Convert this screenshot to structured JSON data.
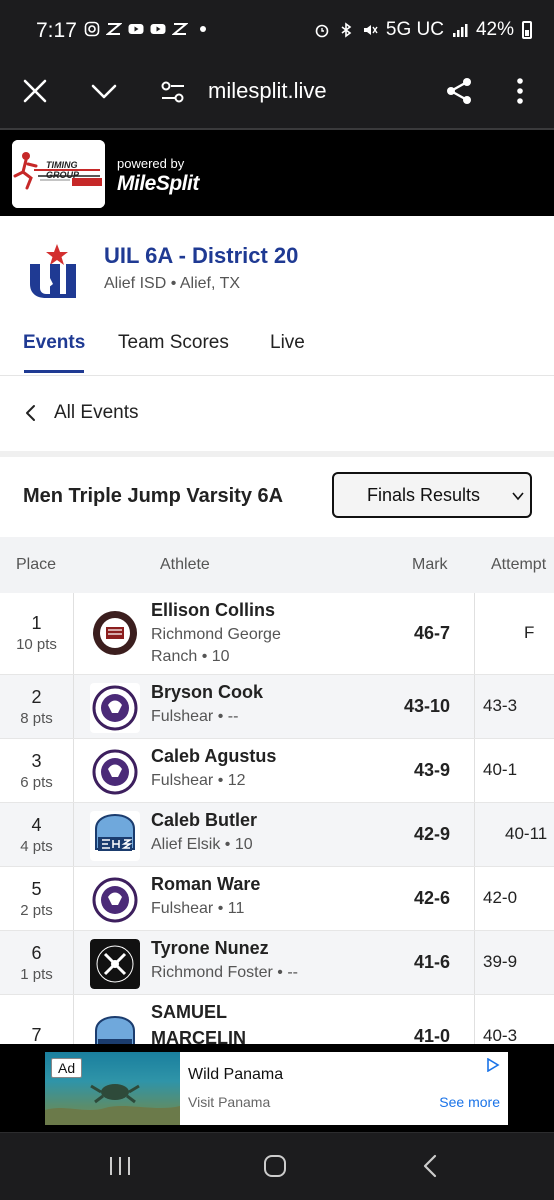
{
  "status_bar": {
    "time": "7:17",
    "network": "5G UC",
    "battery": "42%"
  },
  "browser": {
    "url": "milesplit.live"
  },
  "banner": {
    "powered_by": "powered by",
    "brand": "MileSplit",
    "timing_logo_text": "TIMING GROUP"
  },
  "meet": {
    "title": "UIL 6A - District 20",
    "subtitle": "Alief ISD • Alief, TX",
    "tabs": [
      {
        "label": "Events",
        "active": true
      },
      {
        "label": "Team Scores",
        "active": false
      },
      {
        "label": "Live",
        "active": false
      }
    ]
  },
  "nav": {
    "all_events": "All Events"
  },
  "event": {
    "title": "Men Triple Jump Varsity 6A",
    "round_select": "Finals Results"
  },
  "table": {
    "headers": {
      "place": "Place",
      "athlete": "Athlete",
      "mark": "Mark",
      "attempt": "Attempt"
    },
    "rows": [
      {
        "place": "1",
        "pts": "10 pts",
        "name": "Ellison Collins",
        "team": "Richmond George",
        "team2": "Ranch • 10",
        "mark": "46-7",
        "attempt": "F",
        "logo": "george-ranch"
      },
      {
        "place": "2",
        "pts": "8 pts",
        "name": "Bryson Cook",
        "team": "Fulshear • --",
        "mark": "43-10",
        "attempt": "43-3",
        "logo": "fulshear"
      },
      {
        "place": "3",
        "pts": "6 pts",
        "name": "Caleb Agustus",
        "team": "Fulshear • 12",
        "mark": "43-9",
        "attempt": "40-1",
        "logo": "fulshear"
      },
      {
        "place": "4",
        "pts": "4 pts",
        "name": "Caleb Butler",
        "team": "Alief Elsik • 10",
        "mark": "42-9",
        "attempt": "40-11",
        "logo": "elsik"
      },
      {
        "place": "5",
        "pts": "2 pts",
        "name": "Roman Ware",
        "team": "Fulshear • 11",
        "mark": "42-6",
        "attempt": "42-0",
        "logo": "fulshear"
      },
      {
        "place": "6",
        "pts": "1 pts",
        "name": "Tyrone Nunez",
        "team": "Richmond Foster • --",
        "mark": "41-6",
        "attempt": "39-9",
        "logo": "foster"
      },
      {
        "place": "7",
        "pts": "",
        "name": "SAMUEL",
        "name2": "MARCELIN",
        "team": "",
        "mark": "41-0",
        "attempt": "40-3",
        "logo": "elsik"
      }
    ]
  },
  "ad": {
    "badge": "Ad",
    "title": "Wild Panama",
    "advertiser": "Visit Panama",
    "cta": "See more"
  },
  "colors": {
    "brand_blue": "#1f3a93",
    "uil_red": "#d32f2f",
    "link_blue": "#1a73e8"
  }
}
